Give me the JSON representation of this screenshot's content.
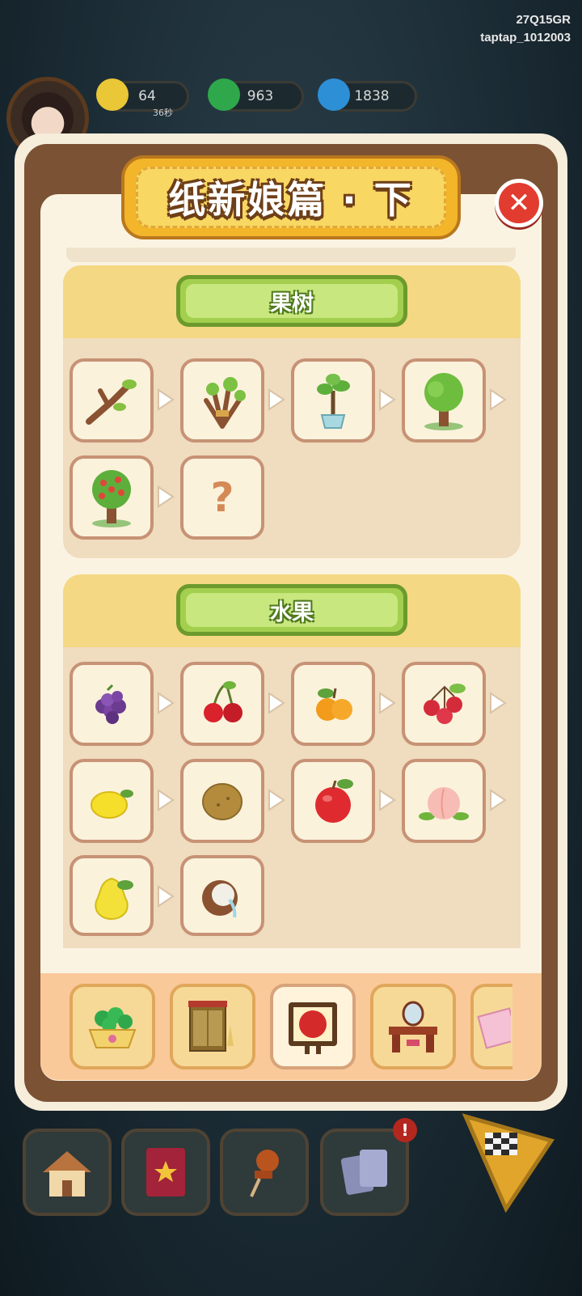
{
  "watermark": {
    "line1": "27Q15GR",
    "line2": "taptap_1012003"
  },
  "hud": {
    "energy": {
      "value": "64",
      "sub": "36秒"
    },
    "coins": {
      "value": "963"
    },
    "flame": {
      "value": "1838"
    }
  },
  "panel": {
    "title": "纸新娘篇 · 下",
    "sections": [
      {
        "title": "果树",
        "items": [
          "branch-icon",
          "bundled-branches-icon",
          "potted-sapling-icon",
          "leafy-tree-icon",
          "fruit-tree-icon",
          "unknown-item-icon"
        ],
        "unknown_mark": "?"
      },
      {
        "title": "水果",
        "items": [
          "mulberry-icon",
          "cherry-icon",
          "orange-icon",
          "hawthorn-icon",
          "lemon-icon",
          "kiwi-icon",
          "apple-icon",
          "peach-icon",
          "quince-icon",
          "coconut-icon"
        ]
      }
    ],
    "bottom_tabs": [
      "jade-bowl-icon",
      "wardrobe-icon",
      "wedding-plaque-icon",
      "vanity-table-icon",
      "gift-box-icon"
    ],
    "active_tab": 2
  },
  "nav": {
    "buttons": [
      "home-icon",
      "book-icon",
      "pushpin-icon",
      "cards-icon"
    ],
    "notification": "!"
  }
}
